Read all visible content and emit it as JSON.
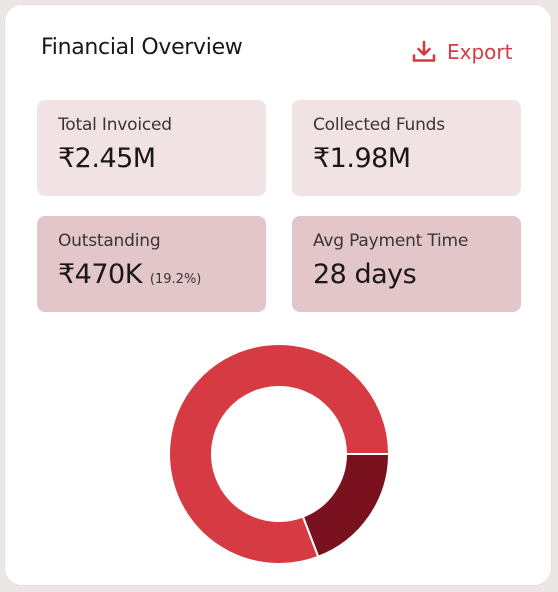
{
  "header": {
    "title": "Financial Overview",
    "export_label": "Export"
  },
  "stats": [
    {
      "label": "Total Invoiced",
      "value": "₹2.45M"
    },
    {
      "label": "Collected Funds",
      "value": "₹1.98M"
    },
    {
      "label": "Outstanding",
      "value": "₹470K",
      "note": "(19.2%)"
    },
    {
      "label": "Avg Payment Time",
      "value": "28 days"
    }
  ],
  "colors": {
    "accent": "#d63a42",
    "collected": "#d63a42",
    "outstanding": "#7a111e",
    "tile_light": "#f1e2e3",
    "tile_dark": "#e2c6c9"
  },
  "icons": {
    "export": "download-icon"
  },
  "chart_data": {
    "type": "pie",
    "categories": [
      "Collected Funds",
      "Outstanding"
    ],
    "values": [
      80.8,
      19.2
    ],
    "colors": [
      "#d63a42",
      "#7a111e"
    ]
  }
}
